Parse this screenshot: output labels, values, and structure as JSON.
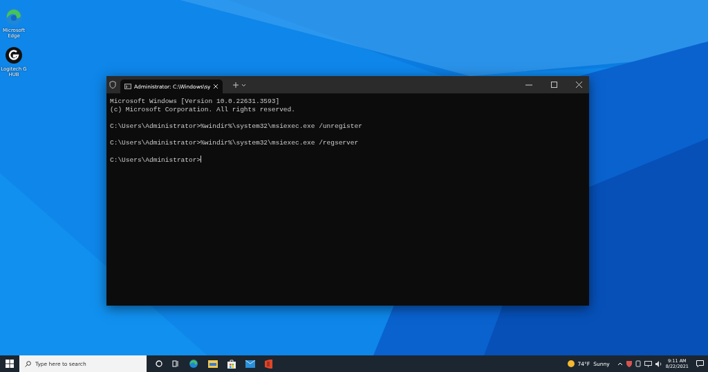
{
  "desktop_icons": [
    {
      "label": "Microsoft Edge"
    },
    {
      "label": "Logitech G HUB"
    }
  ],
  "window": {
    "tab_title": "Administrator: C:\\Windows\\sy",
    "cursor": true,
    "blocks": [
      [
        "Microsoft Windows [Version 10.0.22631.3593]",
        "(c) Microsoft Corporation. All rights reserved."
      ],
      [
        "C:\\Users\\Administrator>%windir%\\system32\\msiexec.exe /unregister"
      ],
      [
        "C:\\Users\\Administrator>%windir%\\system32\\msiexec.exe /regserver"
      ],
      [
        "C:\\Users\\Administrator>"
      ]
    ]
  },
  "taskbar": {
    "search": {
      "placeholder": "Type here to search"
    },
    "weather": {
      "temperature": "74°F",
      "condition": "Sunny"
    },
    "time": "9:11 AM",
    "date": "8/22/2021"
  }
}
